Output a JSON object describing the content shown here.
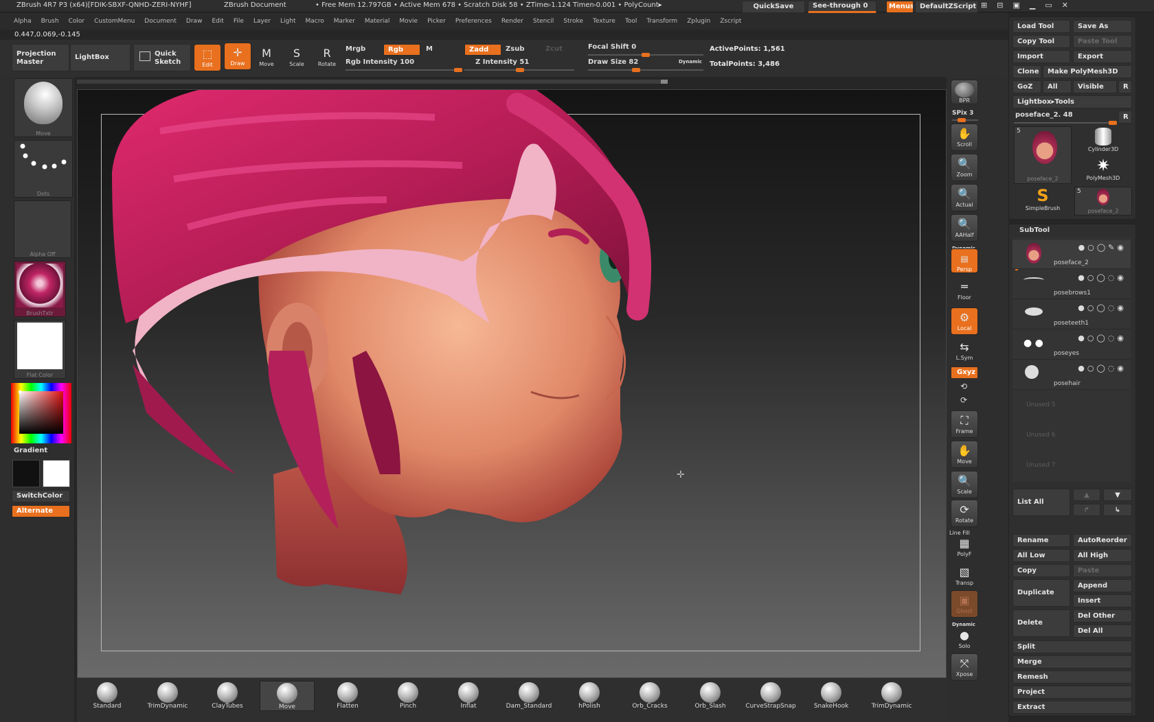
{
  "titlebar": {
    "title": "ZBrush 4R7 P3 (x64)[FDIK-SBXF-QNHD-ZERI-NYHF]",
    "doc": "ZBrush Document",
    "mem": "• Free Mem 12.797GB • Active Mem 678 • Scratch Disk 58 • ZTime▹1.124 Timer▹0.001 • PolyCount▸",
    "quicksave": "QuickSave",
    "seethrough": "See-through  0",
    "menus": "Menus",
    "script": "DefaultZScript"
  },
  "menubar": [
    "Alpha",
    "Brush",
    "Color",
    "CustomMenu",
    "Document",
    "Draw",
    "Edit",
    "File",
    "Layer",
    "Light",
    "Macro",
    "Marker",
    "Material",
    "Movie",
    "Picker",
    "Preferences",
    "Render",
    "Stencil",
    "Stroke",
    "Texture",
    "Tool",
    "Transform",
    "Zplugin",
    "Zscript"
  ],
  "coords": "0.447,0.069,-0.145",
  "topshelf": {
    "projection": "Projection\nMaster",
    "lightbox": "LightBox",
    "quicksketch": "Quick\nSketch",
    "edit": "Edit",
    "draw": "Draw",
    "move": "Move",
    "scale": "Scale",
    "rotate": "Rotate",
    "mrgb": "Mrgb",
    "rgb": "Rgb",
    "m": "M",
    "zadd": "Zadd",
    "zsub": "Zsub",
    "zcut": "Zcut",
    "rgb_intensity": "Rgb Intensity 100",
    "z_intensity": "Z Intensity 51",
    "focal": "Focal Shift 0",
    "drawsize": "Draw Size 82",
    "dynamic": "Dynamic",
    "active": "ActivePoints: 1,561",
    "total": "TotalPoints: 3,486",
    "rgb_intensity_value": 100,
    "z_intensity_value": 51,
    "focal_value": 0,
    "drawsize_value": 82
  },
  "leftshelf": {
    "move": "Move",
    "dots": "Dots",
    "alpha": "Alpha  Off",
    "brushtxtr": "BrushTxtr",
    "flatcolor": "Flat Color",
    "gradient": "Gradient",
    "switchcolor": "SwitchColor",
    "alternate": "Alternate"
  },
  "rightshelf": [
    "BPR",
    "SPix 3",
    "Scroll",
    "Zoom",
    "Actual",
    "AAHalf",
    "Persp",
    "Floor",
    "Local",
    "L.Sym",
    "Frame",
    "Move",
    "Scale",
    "Rotate",
    "PolyF",
    "Transp",
    "Ghost",
    "Solo",
    "Xpose"
  ],
  "rightshelf_extra": {
    "dynamic": "Dynamic",
    "xyz": "Gxyz",
    "linefill": "Line Fill"
  },
  "toolpanel": {
    "load": "Load Tool",
    "saveas": "Save As",
    "copy": "Copy Tool",
    "paste": "Paste Tool",
    "import": "Import",
    "export": "Export",
    "clone": "Clone",
    "makepm": "Make PolyMesh3D",
    "goz": "GoZ",
    "all": "All",
    "visible": "Visible",
    "r": "R",
    "lightbox": "Lightbox▸Tools",
    "current": "poseface_2. 48",
    "tools": [
      {
        "name": "poseface_2",
        "num": "5"
      },
      {
        "name": "Cylinder3D"
      },
      {
        "name": "PolyMesh3D"
      },
      {
        "name": "SimpleBrush"
      },
      {
        "name": "poseface_2",
        "num": "5"
      }
    ]
  },
  "subtool": {
    "title": "SubTool",
    "items": [
      "poseface_2",
      "posebrows1",
      "poseteeth1",
      "poseyes",
      "posehair"
    ],
    "unused": [
      "Unused 5",
      "Unused 6",
      "Unused 7"
    ],
    "listall": "List  All"
  },
  "subtool_actions": {
    "rename": "Rename",
    "autoreorder": "AutoReorder",
    "alllow": "All Low",
    "allhigh": "All High",
    "copy": "Copy",
    "paste": "Paste",
    "duplicate": "Duplicate",
    "append": "Append",
    "insert": "Insert",
    "delete": "Delete",
    "delother": "Del Other",
    "delall": "Del All",
    "split": "Split",
    "merge": "Merge",
    "remesh": "Remesh",
    "project": "Project",
    "extract": "Extract"
  },
  "brushes": [
    "Standard",
    "TrimDynamic",
    "ClayTubes",
    "Move",
    "Flatten",
    "Pinch",
    "Inflat",
    "Dam_Standard",
    "hPolish",
    "Orb_Cracks",
    "Orb_Slash",
    "CurveStrapSnap",
    "SnakeHook",
    "TrimDynamic"
  ]
}
